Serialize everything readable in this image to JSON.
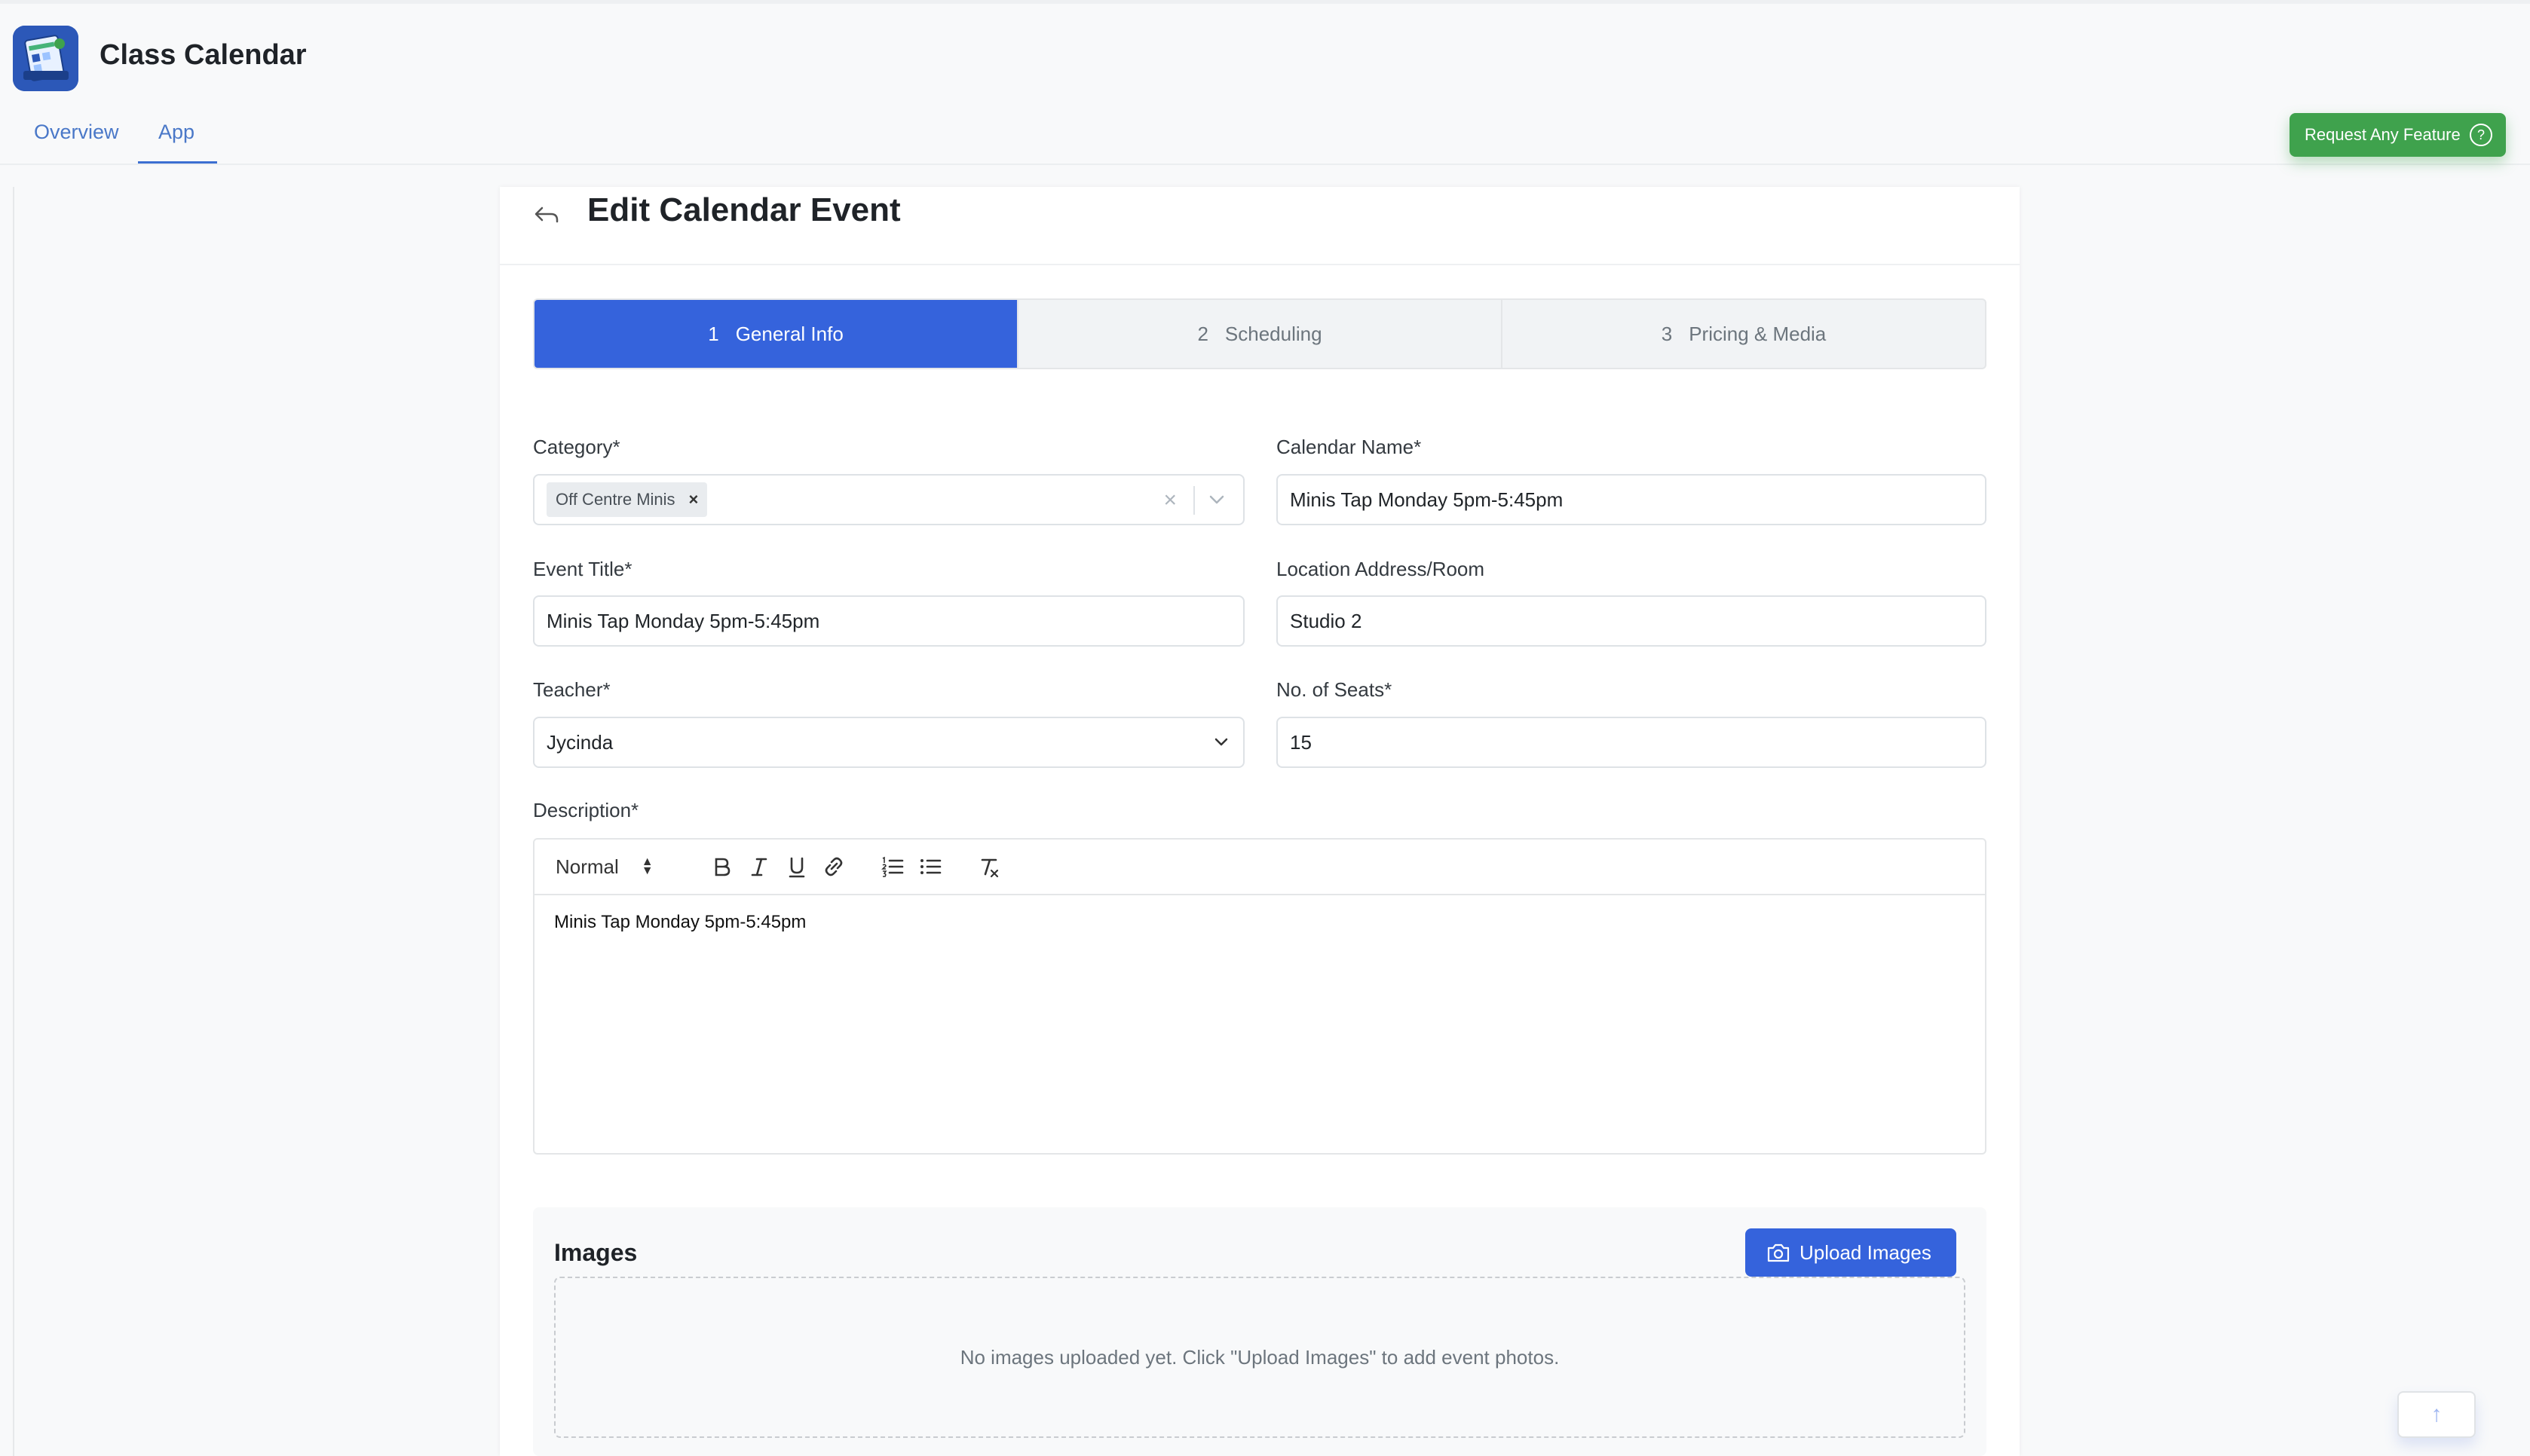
{
  "app": {
    "title": "Class Calendar"
  },
  "tabs": [
    {
      "label": "Overview"
    },
    {
      "label": "App"
    }
  ],
  "header": {
    "request_feature_label": "Request Any Feature",
    "help_glyph": "?"
  },
  "page": {
    "title": "Edit Calendar Event"
  },
  "steps": [
    {
      "num": "1",
      "label": "General Info",
      "active": true
    },
    {
      "num": "2",
      "label": "Scheduling",
      "active": false
    },
    {
      "num": "3",
      "label": "Pricing & Media",
      "active": false
    }
  ],
  "form": {
    "category": {
      "label": "Category*",
      "chip": "Off Centre Minis",
      "chip_remove": "×",
      "clear": "×"
    },
    "calendar_name": {
      "label": "Calendar Name*",
      "value": "Minis Tap Monday 5pm-5:45pm"
    },
    "event_title": {
      "label": "Event Title*",
      "value": "Minis Tap Monday 5pm-5:45pm"
    },
    "location": {
      "label": "Location Address/Room",
      "value": "Studio 2"
    },
    "teacher": {
      "label": "Teacher*",
      "value": "Jycinda"
    },
    "seats": {
      "label": "No. of Seats*",
      "value": "15"
    },
    "description": {
      "label": "Description*",
      "format": "Normal",
      "value": "Minis Tap Monday 5pm-5:45pm"
    }
  },
  "images": {
    "title": "Images",
    "upload_label": "Upload Images",
    "empty_text": "No images uploaded yet. Click \"Upload Images\" to add event photos."
  },
  "scroll_top_glyph": "↑",
  "colors": {
    "primary": "#3563dc",
    "success": "#3fa24d",
    "link": "#4a78c8"
  }
}
